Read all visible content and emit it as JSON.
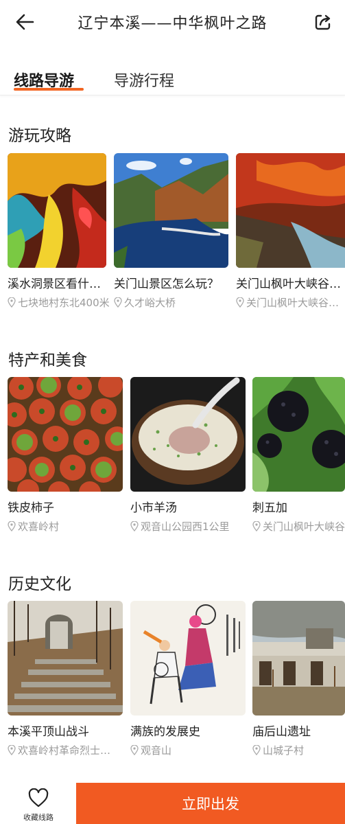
{
  "header": {
    "title": "辽宁本溪——中华枫叶之路"
  },
  "tabs": {
    "active": "线路导游",
    "inactive": "导游行程",
    "accent": "#f26522"
  },
  "sections": {
    "guide": {
      "title": "游玩攻略",
      "items": [
        {
          "name": "溪水洞景区看什…",
          "location": "七块地村东北400米"
        },
        {
          "name": "关门山景区怎么玩？",
          "location": "久才峪大桥"
        },
        {
          "name": "关门山枫叶大峡谷…",
          "location": "关门山枫叶大峡谷…"
        }
      ]
    },
    "food": {
      "title": "特产和美食",
      "items": [
        {
          "name": "铁皮柿子",
          "location": "欢喜岭村"
        },
        {
          "name": "小市羊汤",
          "location": "观音山公园西1公里"
        },
        {
          "name": "刺五加",
          "location": "关门山枫叶大峡谷"
        }
      ]
    },
    "culture": {
      "title": "历史文化",
      "items": [
        {
          "name": "本溪平顶山战斗",
          "location": "欢喜岭村革命烈士…"
        },
        {
          "name": "满族的发展史",
          "location": "观音山"
        },
        {
          "name": "庙后山遗址",
          "location": "山城子村"
        }
      ]
    }
  },
  "bottom": {
    "favorite_label": "收藏线路",
    "start_label": "立即出发",
    "button_color": "#f15a22"
  }
}
